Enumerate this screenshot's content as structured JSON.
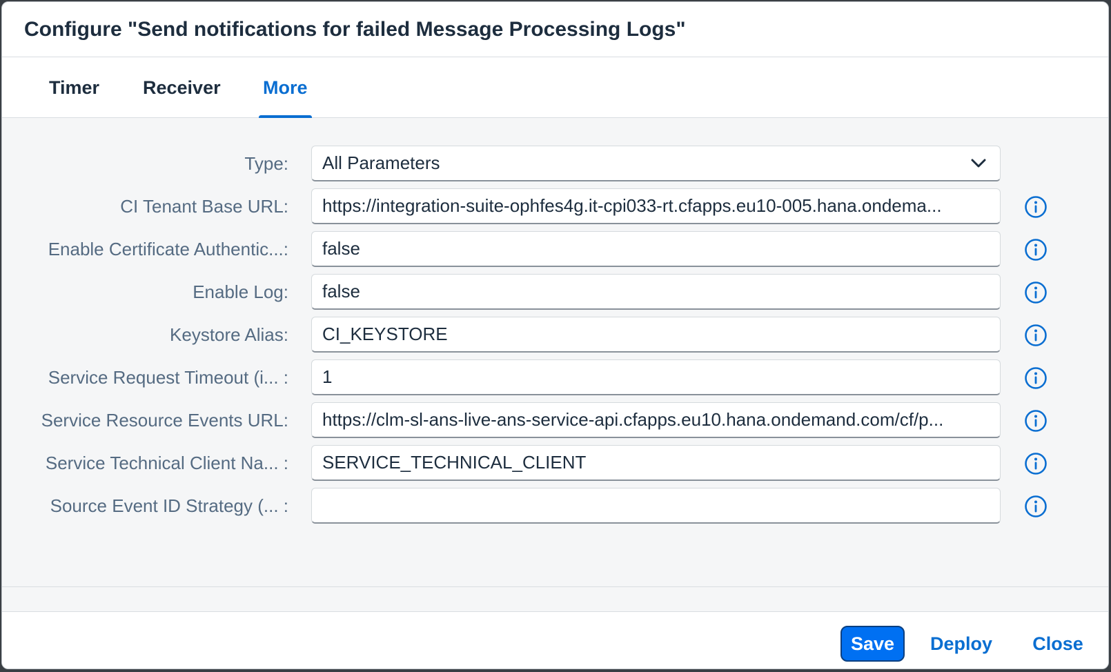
{
  "dialog": {
    "title": "Configure \"Send notifications for failed Message Processing Logs\""
  },
  "tabs": [
    {
      "label": "Timer",
      "selected": false
    },
    {
      "label": "Receiver",
      "selected": false
    },
    {
      "label": "More",
      "selected": true
    }
  ],
  "form": {
    "rows": [
      {
        "label": "Type:",
        "value": "All Parameters",
        "kind": "select",
        "info": false
      },
      {
        "label": "CI Tenant Base URL:",
        "value": "https://integration-suite-ophfes4g.it-cpi033-rt.cfapps.eu10-005.hana.ondema...",
        "kind": "input",
        "info": true
      },
      {
        "label": "Enable Certificate Authentic...:",
        "value": "false",
        "kind": "input",
        "info": true
      },
      {
        "label": "Enable Log:",
        "value": "false",
        "kind": "input",
        "info": true
      },
      {
        "label": "Keystore Alias:",
        "value": "CI_KEYSTORE",
        "kind": "input",
        "info": true
      },
      {
        "label": "Service Request Timeout (i... :",
        "value": "1",
        "kind": "input",
        "info": true
      },
      {
        "label": "Service Resource Events URL:",
        "value": "https://clm-sl-ans-live-ans-service-api.cfapps.eu10.hana.ondemand.com/cf/p...",
        "kind": "input",
        "info": true
      },
      {
        "label": "Service Technical Client Na... :",
        "value": "SERVICE_TECHNICAL_CLIENT",
        "kind": "input",
        "info": true
      },
      {
        "label": "Source Event ID Strategy (... :",
        "value": "",
        "kind": "input",
        "info": true
      }
    ]
  },
  "footer": {
    "save_label": "Save",
    "deploy_label": "Deploy",
    "close_label": "Close"
  },
  "colors": {
    "accent": "#0a6ed1",
    "primary_button": "#0070f2",
    "label_text": "#556b82",
    "content_bg": "#f5f6f7"
  },
  "icons": {
    "select_arrow": "chevron-down-icon",
    "info": "info-icon"
  }
}
